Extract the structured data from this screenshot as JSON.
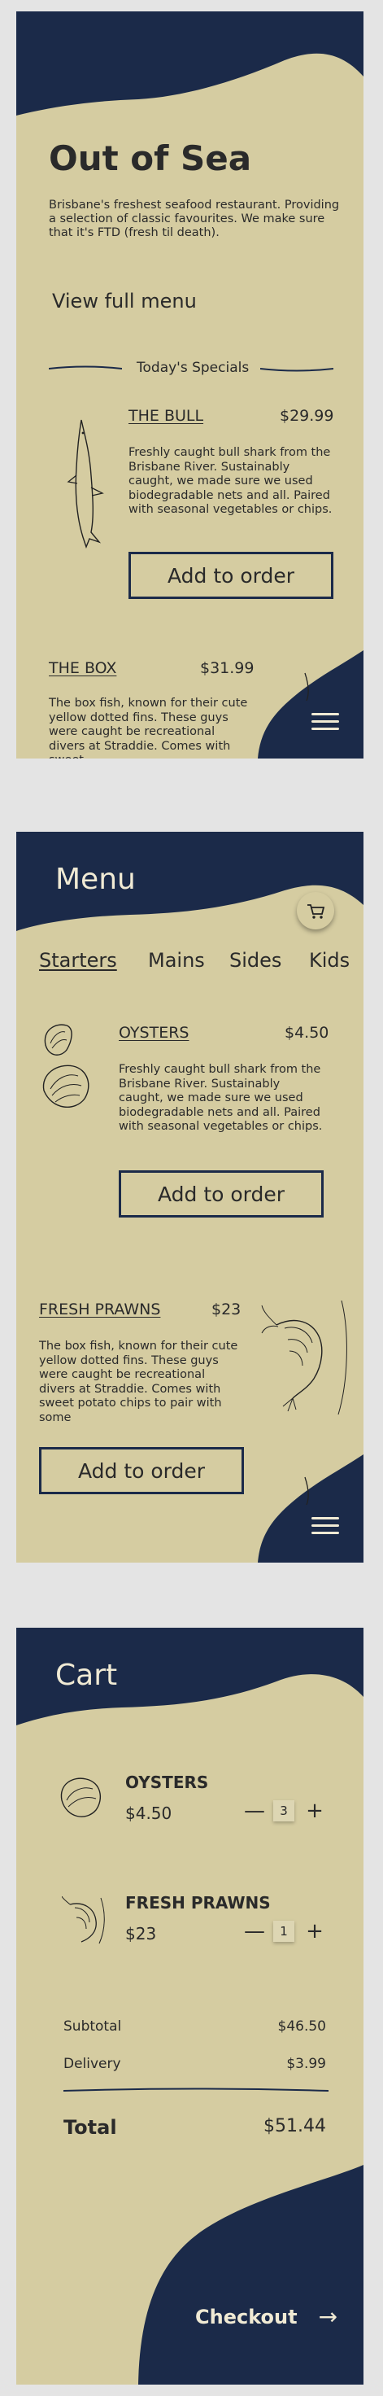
{
  "home": {
    "title": "Out of Sea",
    "intro": "Brisbane's freshest seafood restaurant. Providing a selection of classic favourites. We make sure that it's FTD (fresh til death).",
    "view_menu": "View full menu",
    "specials_heading": "Today's Specials",
    "specials": [
      {
        "name": "THE BULL",
        "price": "$29.99",
        "description": "Freshly caught bull shark from the Brisbane River. Sustainably caught, we made sure we used biodegradable nets and all. Paired with seasonal vegetables or chips.",
        "button": "Add to order"
      },
      {
        "name": "THE BOX",
        "price": "$31.99",
        "description": "The box fish, known for their cute yellow dotted fins. These guys were caught be recreational divers at Straddie. Comes with sweet"
      }
    ],
    "menu_icon": "hamburger-icon"
  },
  "menu_screen": {
    "title": "Menu",
    "cart_icon": "cart-icon",
    "tabs": [
      "Starters",
      "Mains",
      "Sides",
      "Kids"
    ],
    "active_tab": "Starters",
    "items": [
      {
        "name": "OYSTERS",
        "price": "$4.50",
        "description": "Freshly caught bull shark from the Brisbane River. Sustainably caught, we made sure we used biodegradable nets and all. Paired with seasonal vegetables or chips.",
        "button": "Add to order"
      },
      {
        "name": "FRESH PRAWNS",
        "price": "$23",
        "description": "The box fish, known for their cute yellow dotted fins. These guys were caught be recreational divers at Straddie. Comes with sweet potato chips to pair with some",
        "button": "Add to order"
      }
    ]
  },
  "cart": {
    "title": "Cart",
    "items": [
      {
        "name": "OYSTERS",
        "price": "$4.50",
        "qty": "3"
      },
      {
        "name": "FRESH PRAWNS",
        "price": "$23",
        "qty": "1"
      }
    ],
    "minus": "—",
    "plus": "+",
    "subtotal_label": "Subtotal",
    "subtotal": "$46.50",
    "delivery_label": "Delivery",
    "delivery": "$3.99",
    "total_label": "Total",
    "total": "$51.44",
    "checkout": "Checkout",
    "checkout_arrow": "→"
  },
  "colors": {
    "navy": "#1b2a49",
    "sand": "#d5cca1",
    "text": "#2a2a2a"
  }
}
